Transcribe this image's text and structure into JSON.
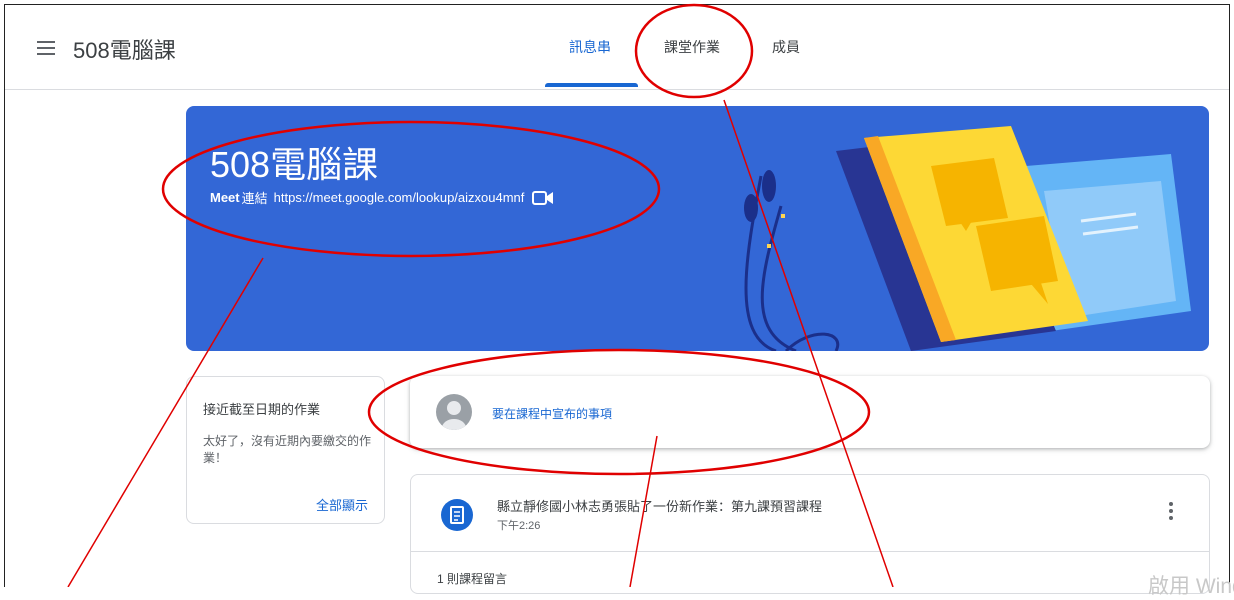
{
  "header": {
    "class_name": "508電腦課",
    "tabs": [
      {
        "label": "訊息串",
        "active": true
      },
      {
        "label": "課堂作業",
        "active": false
      },
      {
        "label": "成員",
        "active": false
      }
    ]
  },
  "banner": {
    "title": "508電腦課",
    "meet_label": "Meet",
    "meet_suffix": "連結",
    "meet_link": "https://meet.google.com/lookup/aizxou4mnf"
  },
  "upcoming": {
    "title": "接近截至日期的作業",
    "message": "太好了，沒有近期內要繳交的作業！",
    "view_all": "全部顯示"
  },
  "announce": {
    "placeholder": "要在課程中宣布的事項"
  },
  "post": {
    "title": "縣立靜修國小林志勇張貼了一份新作業：第九課預習課程",
    "time": "下午2:26",
    "comments": "1 則課程留言"
  },
  "watermark": "啟用 Windows",
  "colors": {
    "accent": "#1967d2",
    "banner": "#3367d6",
    "annotation": "#e00000"
  }
}
